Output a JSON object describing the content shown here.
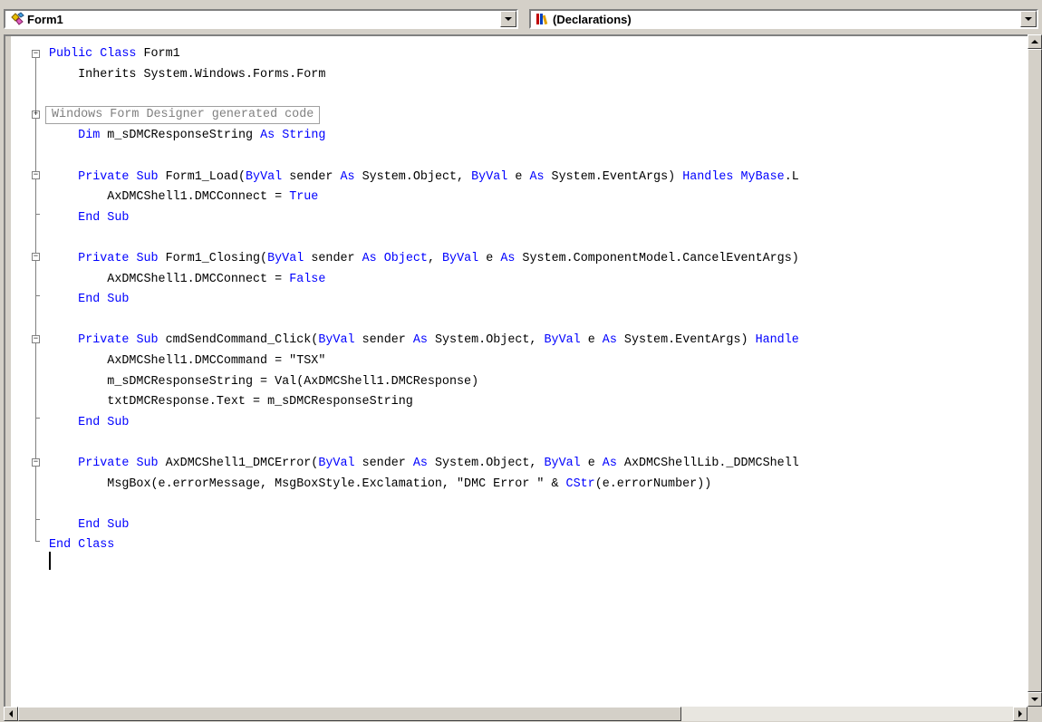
{
  "combos": {
    "class_name": "Form1",
    "class_icon": "class-icon",
    "method_name": "(Declarations)",
    "method_icon": "declarations-icon"
  },
  "editor": {
    "collapsed_region": "Windows Form Designer generated code",
    "lines": [
      [
        {
          "t": "Public Class",
          "k": true
        },
        {
          "t": " Form1"
        }
      ],
      [
        {
          "t": "    Inherits System.Windows.Forms.Form"
        }
      ],
      [],
      [],
      [
        {
          "t": "    "
        },
        {
          "t": "Dim",
          "k": true
        },
        {
          "t": " m_sDMCResponseString "
        },
        {
          "t": "As",
          "k": true
        },
        {
          "t": " "
        },
        {
          "t": "String",
          "k": true
        }
      ],
      [],
      [
        {
          "t": "    "
        },
        {
          "t": "Private Sub",
          "k": true
        },
        {
          "t": " Form1_Load("
        },
        {
          "t": "ByVal",
          "k": true
        },
        {
          "t": " sender "
        },
        {
          "t": "As",
          "k": true
        },
        {
          "t": " System.Object, "
        },
        {
          "t": "ByVal",
          "k": true
        },
        {
          "t": " e "
        },
        {
          "t": "As",
          "k": true
        },
        {
          "t": " System.EventArgs) "
        },
        {
          "t": "Handles",
          "k": true
        },
        {
          "t": " "
        },
        {
          "t": "MyBase",
          "k": true
        },
        {
          "t": ".L"
        }
      ],
      [
        {
          "t": "        AxDMCShell1.DMCConnect = "
        },
        {
          "t": "True",
          "k": true
        }
      ],
      [
        {
          "t": "    "
        },
        {
          "t": "End Sub",
          "k": true
        }
      ],
      [],
      [
        {
          "t": "    "
        },
        {
          "t": "Private Sub",
          "k": true
        },
        {
          "t": " Form1_Closing("
        },
        {
          "t": "ByVal",
          "k": true
        },
        {
          "t": " sender "
        },
        {
          "t": "As",
          "k": true
        },
        {
          "t": " "
        },
        {
          "t": "Object",
          "k": true
        },
        {
          "t": ", "
        },
        {
          "t": "ByVal",
          "k": true
        },
        {
          "t": " e "
        },
        {
          "t": "As",
          "k": true
        },
        {
          "t": " System.ComponentModel.CancelEventArgs)"
        }
      ],
      [
        {
          "t": "        AxDMCShell1.DMCConnect = "
        },
        {
          "t": "False",
          "k": true
        }
      ],
      [
        {
          "t": "    "
        },
        {
          "t": "End Sub",
          "k": true
        }
      ],
      [],
      [
        {
          "t": "    "
        },
        {
          "t": "Private Sub",
          "k": true
        },
        {
          "t": " cmdSendCommand_Click("
        },
        {
          "t": "ByVal",
          "k": true
        },
        {
          "t": " sender "
        },
        {
          "t": "As",
          "k": true
        },
        {
          "t": " System.Object, "
        },
        {
          "t": "ByVal",
          "k": true
        },
        {
          "t": " e "
        },
        {
          "t": "As",
          "k": true
        },
        {
          "t": " System.EventArgs) "
        },
        {
          "t": "Handle",
          "k": true
        }
      ],
      [
        {
          "t": "        AxDMCShell1.DMCCommand = \"TSX\""
        }
      ],
      [
        {
          "t": "        m_sDMCResponseString = Val(AxDMCShell1.DMCResponse)"
        }
      ],
      [
        {
          "t": "        txtDMCResponse.Text = m_sDMCResponseString"
        }
      ],
      [
        {
          "t": "    "
        },
        {
          "t": "End Sub",
          "k": true
        }
      ],
      [],
      [
        {
          "t": "    "
        },
        {
          "t": "Private Sub",
          "k": true
        },
        {
          "t": " AxDMCShell1_DMCError("
        },
        {
          "t": "ByVal",
          "k": true
        },
        {
          "t": " sender "
        },
        {
          "t": "As",
          "k": true
        },
        {
          "t": " System.Object, "
        },
        {
          "t": "ByVal",
          "k": true
        },
        {
          "t": " e "
        },
        {
          "t": "As",
          "k": true
        },
        {
          "t": " AxDMCShellLib._DDMCShell"
        }
      ],
      [
        {
          "t": "        MsgBox(e.errorMessage, MsgBoxStyle.Exclamation, \"DMC Error \" & "
        },
        {
          "t": "CStr",
          "k": true
        },
        {
          "t": "(e.errorNumber))"
        }
      ],
      [],
      [
        {
          "t": "    "
        },
        {
          "t": "End Sub",
          "k": true
        }
      ],
      [
        {
          "t": "End Class",
          "k": true
        }
      ]
    ]
  },
  "colors": {
    "keyword": "#0000ff",
    "text": "#000000",
    "collapsed": "#808080",
    "chrome": "#d4d0c8"
  }
}
